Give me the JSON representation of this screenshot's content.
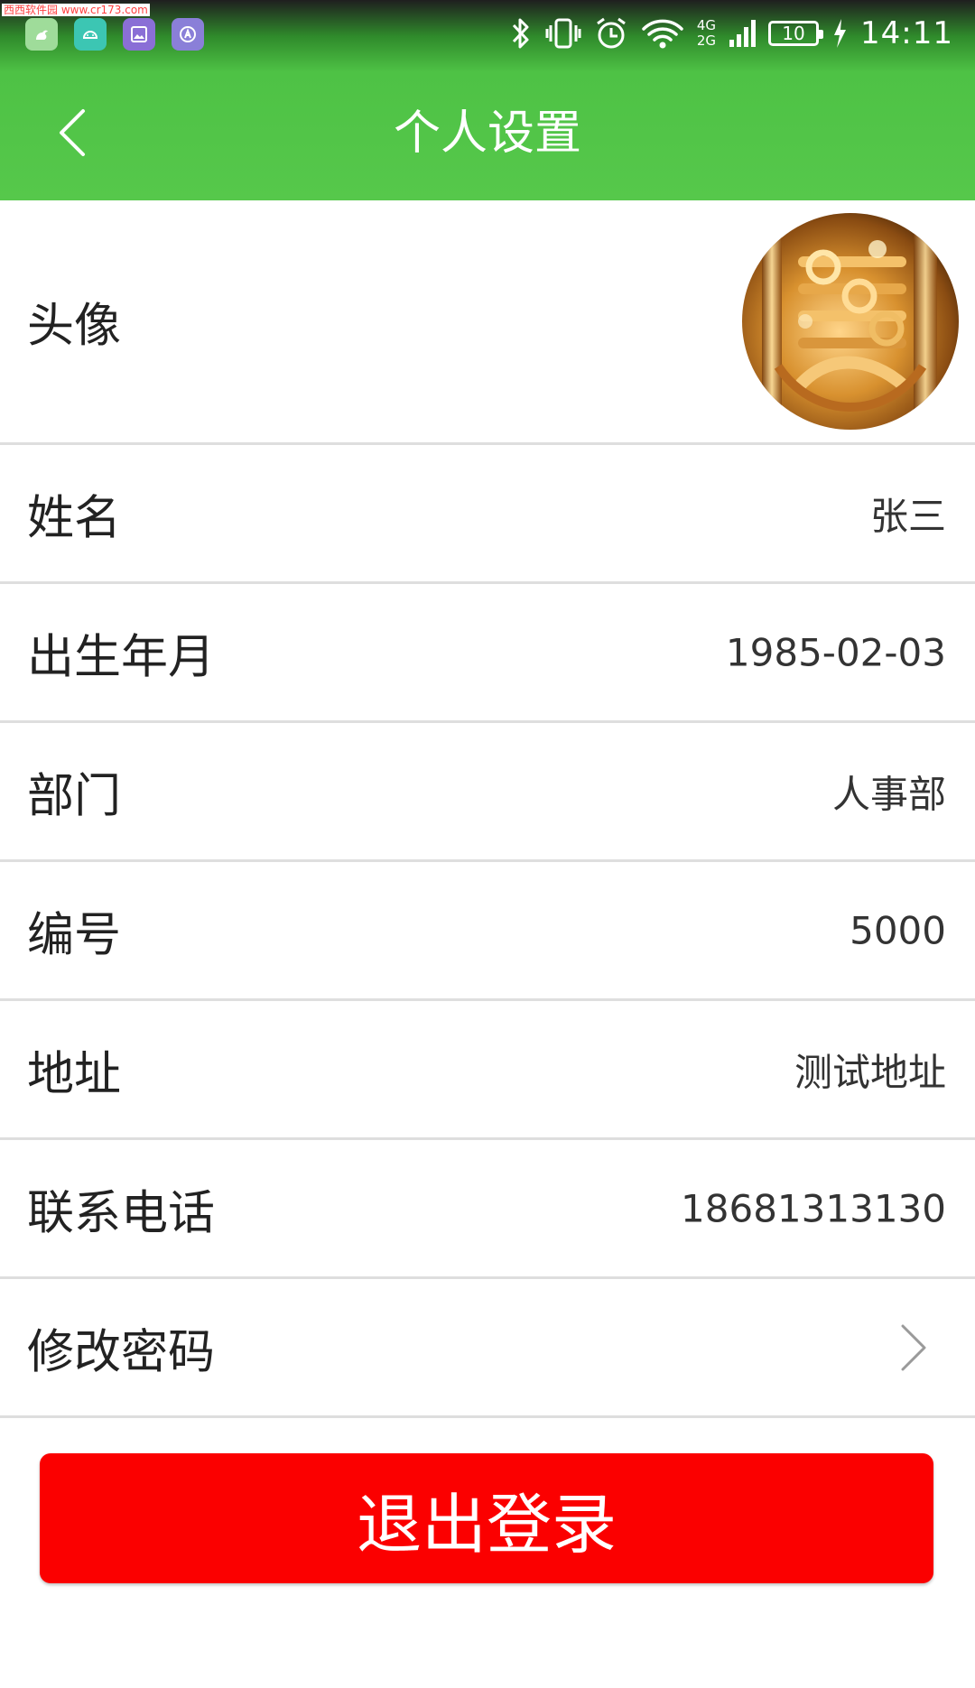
{
  "status_bar": {
    "watermark": "西西软件园 www.cr173.com",
    "app_icons": [
      "app-icon-squirrel",
      "android-icon",
      "gallery-icon",
      "app-store-icon"
    ],
    "icons": [
      "bluetooth-icon",
      "vibrate-icon",
      "alarm-icon",
      "wifi-icon",
      "signal-icon"
    ],
    "network_top": "4G",
    "network_bottom": "2G",
    "battery_level": "10",
    "time": "14:11"
  },
  "header": {
    "title": "个人设置",
    "back_icon": "chevron-left-icon"
  },
  "profile": {
    "avatar_label": "头像",
    "avatar_image": "brass-tuba-valves-photo",
    "name_label": "姓名",
    "name_value": "张三",
    "birth_label": "出生年月",
    "birth_value": "1985-02-03",
    "dept_label": "部门",
    "dept_value": "人事部",
    "id_label": "编号",
    "id_value": "5000",
    "address_label": "地址",
    "address_value": "测试地址",
    "phone_label": "联系电话",
    "phone_value": "18681313130",
    "password_label": "修改密码",
    "password_icon": "chevron-right-icon"
  },
  "logout": {
    "label": "退出登录"
  },
  "colors": {
    "header_green": "#56c84b",
    "logout_red": "#fb0000",
    "divider": "#dedede"
  }
}
